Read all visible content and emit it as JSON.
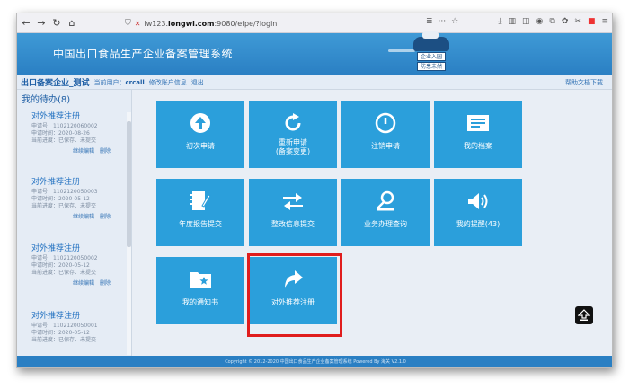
{
  "browser": {
    "url_prefix": "lw123.",
    "url_domain": "longwi.com",
    "url_suffix": ":9080/efpe/?login",
    "page_menu": "≣",
    "more": "···",
    "star": "☆"
  },
  "site": {
    "title": "中国出口食品生产企业备案管理系统",
    "logo_line1": "企业入园",
    "logo_line2": "防患未然"
  },
  "subheader": {
    "company": "出口备案企业_测试",
    "user_label": "当前用户：",
    "user_name": "crcall",
    "edit_link": "修改账户信息",
    "logout_link": "退出",
    "help_link": "帮助文档下载"
  },
  "todo": {
    "title": "我的待办(8)",
    "items": [
      {
        "name": "对外推荐注册",
        "line1": "申请号：1102120060002",
        "line2": "申请时间：2020-08-26",
        "line3": "当前进度：已保存、未提交",
        "edit": "继续编辑",
        "delete": "删除"
      },
      {
        "name": "对外推荐注册",
        "line1": "申请号：1102120050003",
        "line2": "申请时间：2020-05-12",
        "line3": "当前进度：已保存、未提交",
        "edit": "继续编辑",
        "delete": "删除"
      },
      {
        "name": "对外推荐注册",
        "line1": "申请号：1102120050002",
        "line2": "申请时间：2020-05-12",
        "line3": "当前进度：已保存、未提交",
        "edit": "继续编辑",
        "delete": "删除"
      },
      {
        "name": "对外推荐注册",
        "line1": "申请号：1102120050001",
        "line2": "申请时间：2020-05-12",
        "line3": "当前进度：已保存、未提交",
        "edit": "",
        "delete": ""
      }
    ]
  },
  "tiles": [
    {
      "label": "初次申请",
      "icon": "arrow-up-circle-icon"
    },
    {
      "label": "重新申请\n(备案变更)",
      "icon": "refresh-icon"
    },
    {
      "label": "注销申请",
      "icon": "power-icon"
    },
    {
      "label": "我的档案",
      "icon": "document-icon"
    },
    {
      "label": "年度报告提交",
      "icon": "notebook-pen-icon"
    },
    {
      "label": "整改信息提交",
      "icon": "swap-arrows-icon"
    },
    {
      "label": "业务办理查询",
      "icon": "search-person-icon"
    },
    {
      "label": "我的提醒(43)",
      "icon": "speaker-icon"
    },
    {
      "label": "我的通知书",
      "icon": "folder-star-icon"
    },
    {
      "label": "对外推荐注册",
      "icon": "share-arrow-icon"
    }
  ],
  "footer": {
    "text": "Copyright © 2012-2020 中国出口食品生产企业备案管理系统 Powered By 海关 V2.1.0"
  },
  "colors": {
    "tile": "#2b9fdb",
    "header": "#2a7fc3",
    "highlight": "#e01d1d"
  }
}
